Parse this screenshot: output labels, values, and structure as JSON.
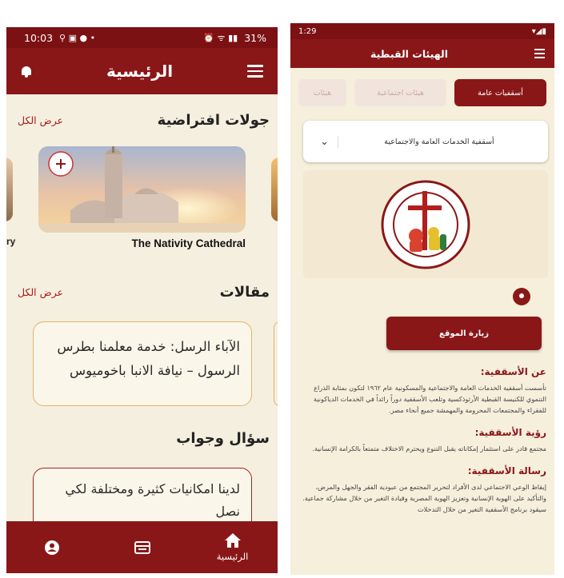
{
  "left": {
    "status": {
      "time": "10:03",
      "battery": "31%"
    },
    "header": {
      "title": "الرئيسية"
    },
    "tours": {
      "title": "جولات افتراضية",
      "see_all": "عرض الكل",
      "card_caption": "The Nativity Cathedral",
      "peek_caption": "ry"
    },
    "articles": {
      "title": "مقالات",
      "see_all": "عرض الكل",
      "card_text": "الآباء الرسل: خدمة معلمنا بطرس الرسول – نيافة الانبا باخوميوس"
    },
    "qa": {
      "title": "سؤال وجواب",
      "card_text": "لدينا امكانيات كثيرة ومختلفة لكي نصل"
    },
    "bottom_nav": {
      "home_label": "الرئيسية"
    },
    "colors": {
      "primary": "#8a1718",
      "background": "#f5efdf",
      "accent_border": "#e3b46a"
    }
  },
  "right": {
    "status": {
      "time": "1:29"
    },
    "header": {
      "title": "الهيئات القبطية"
    },
    "tabs": [
      {
        "label": "أسقفيات عامة",
        "active": true
      },
      {
        "label": "هيئات اجتماعية",
        "active": false
      },
      {
        "label": "هيئات",
        "active": false
      }
    ],
    "dropdown": {
      "selected": "أسقفية الخدمات العامة والاجتماعية"
    },
    "visit_button": "زيارة الموقع",
    "about": {
      "title": "عن الأسقفية:",
      "body": "تأسست أسقفية الخدمات العامة والاجتماعية والمسكونية عام ١٩٦٢ لتكون بمثابة الذراع التنموي للكنيسة القبطية الأرثوذكسية وتلعب الأسقفية دوراً رائداً في الخدمات الدياكونية للفقراء والمجتمعات المحرومة والمهمشة جميع أنحاء مصر."
    },
    "vision": {
      "title": "رؤية الأسقفية:",
      "body": "مجتمع قادر على استثمار إمكاناته يقبل التنوع ويحترم الاختلاف متمتعاً بالكرامة الإنسانية."
    },
    "mission": {
      "title": "رسالة الأسقفية:",
      "body": "إيقاظ الوعي الاجتماعي لدى الأفراد لتحرير المجتمع من عبودية الفقر والجهل والمرض، والتأكيد على الهوية الإنسانية وتعزيز الهوية المصرية وقيادة التغير من خلال مشاركة جماعية. سيقود برنامج الأسقفية التغير من خلال التدخلات"
    }
  }
}
